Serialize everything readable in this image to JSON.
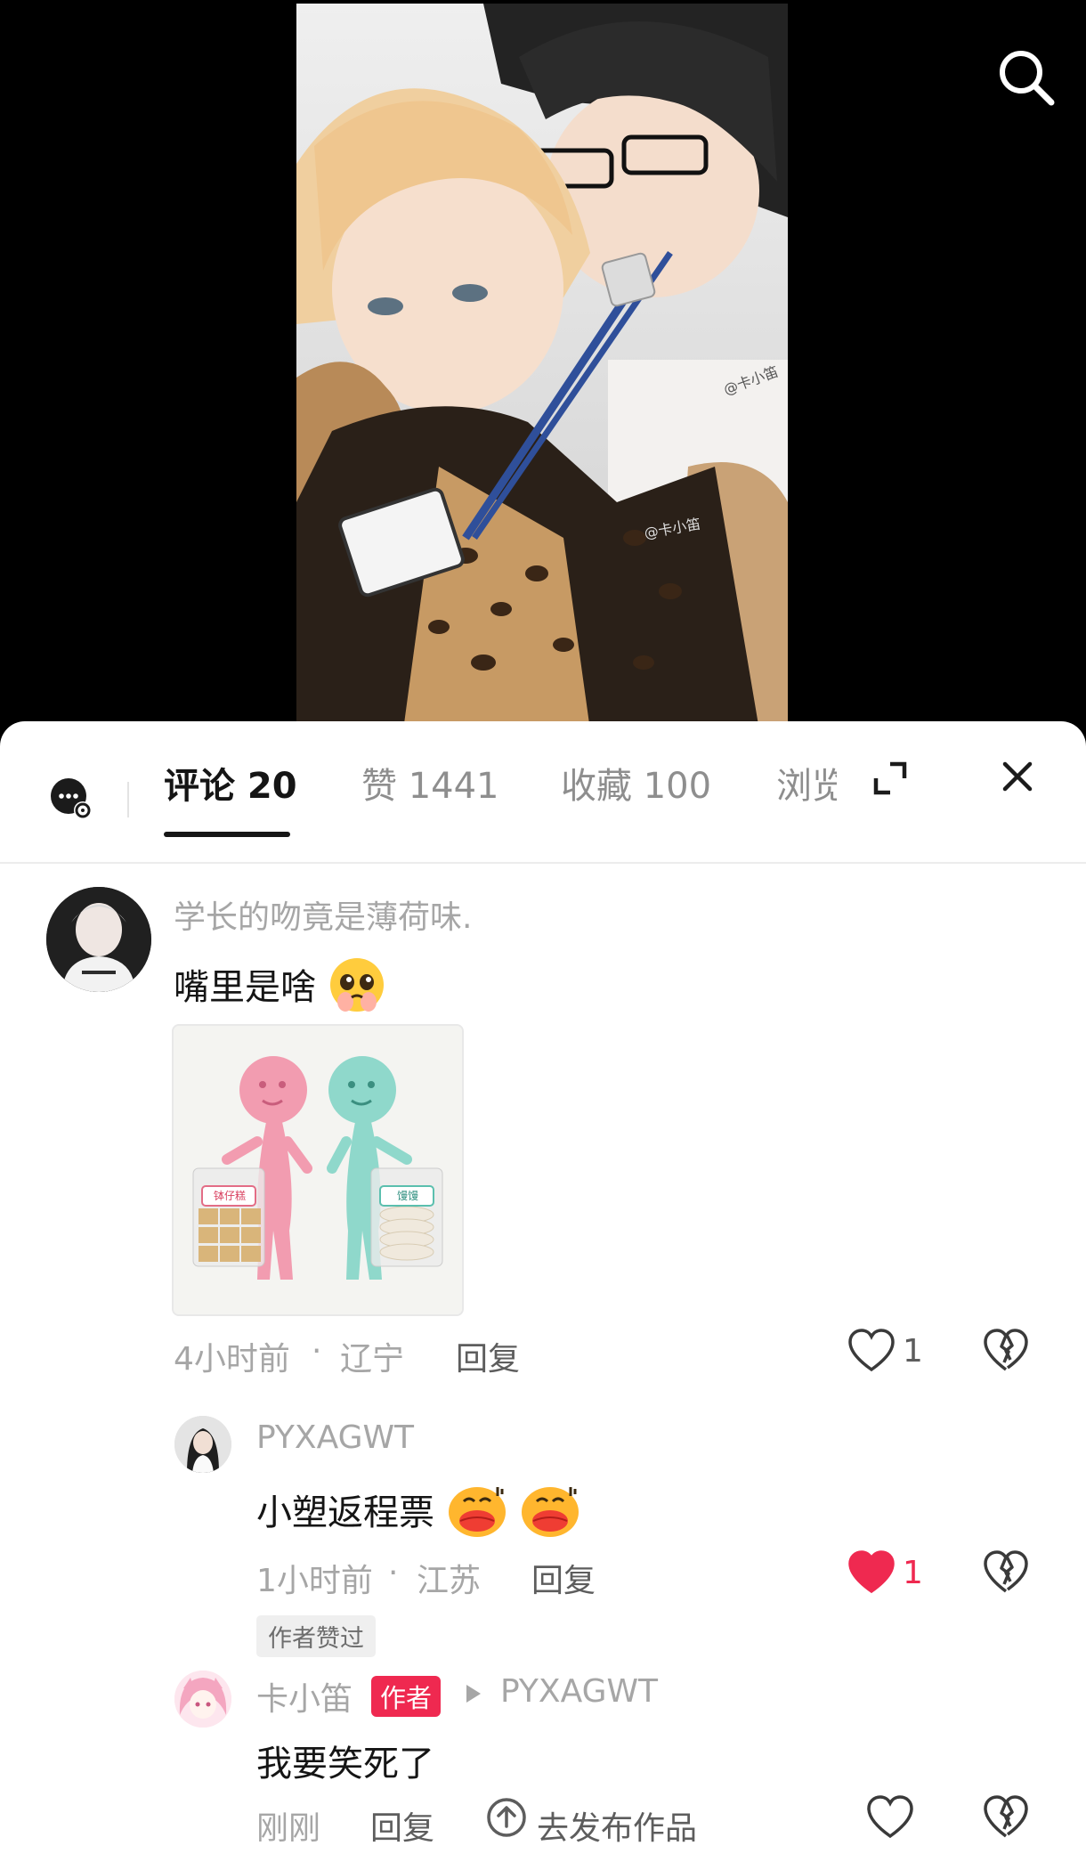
{
  "tabs": [
    {
      "label": "评论 20"
    },
    {
      "label": "赞 1441"
    },
    {
      "label": "收藏 100"
    },
    {
      "label": "浏览"
    }
  ],
  "watermarks": [
    "@卡小笛",
    "@卡小笛"
  ],
  "comments": [
    {
      "username": "学长的吻竟是薄荷味.",
      "text": "嘴里是啥",
      "image_labels": [
        "钵仔糕",
        "馒馒"
      ],
      "time": "4小时前",
      "location": "辽宁",
      "reply_label": "回复",
      "like_count": "1",
      "liked": false
    },
    {
      "username": "PYXAGWT",
      "text": "小塑返程票",
      "time": "1小时前",
      "location": "江苏",
      "reply_label": "回复",
      "like_count": "1",
      "liked": true,
      "author_liked_label": "作者赞过"
    },
    {
      "username": "卡小笛",
      "author_badge": "作者",
      "reply_to": "PYXAGWT",
      "text": "我要笑死了",
      "time": "刚刚",
      "reply_label": "回复",
      "publish_label": "去发布作品",
      "liked": false
    }
  ],
  "colors": {
    "like_red": "#ef2950",
    "author_badge": "#ef2950",
    "text": "#151515",
    "muted": "#a6a6a6"
  }
}
